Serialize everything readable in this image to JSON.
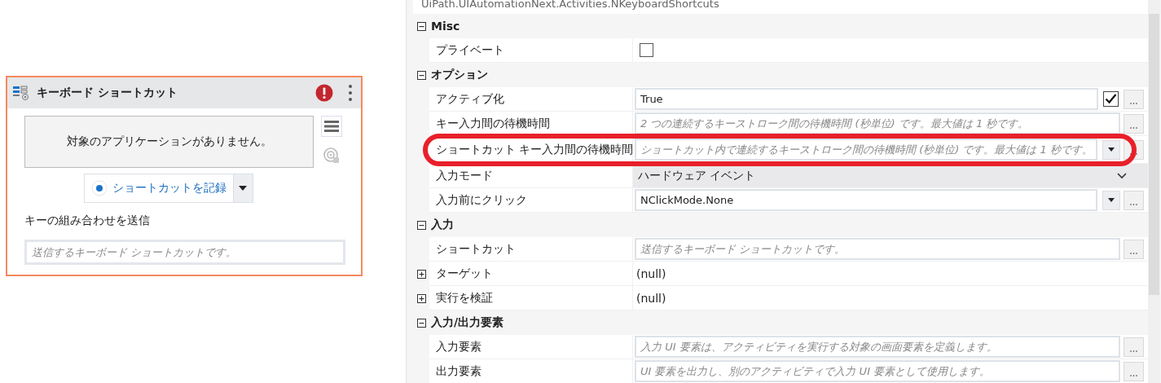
{
  "activity": {
    "title": "キーボード ショートカット",
    "error": true,
    "target_message": "対象のアプリケーションがありません。",
    "record_button": "ショートカットを記録",
    "section_label": "キーの組み合わせを送信",
    "shortcut_field": {
      "placeholder": "送信するキーボード ショートカットです。"
    }
  },
  "properties": {
    "type_name": "UiPath.UIAutomationNext.Activities.NKeyboardShortcuts",
    "rows": [
      {
        "kind": "category",
        "label": "Misc",
        "expanded": true
      },
      {
        "kind": "property",
        "label": "プライベート",
        "editor": {
          "kind": "checkbox",
          "checked": false
        },
        "dots": false,
        "highlighted": false
      },
      {
        "kind": "category",
        "label": "オプション",
        "expanded": true
      },
      {
        "kind": "property",
        "label": "アクティブ化",
        "editor": {
          "kind": "text",
          "value": "True"
        },
        "extra": {
          "kind": "checkbox",
          "checked": true
        },
        "dots": true,
        "highlighted": false
      },
      {
        "kind": "property",
        "label": "キー入力間の待機時間",
        "editor": {
          "kind": "text",
          "placeholder": "2 つの連続するキーストローク間の待機時間 (秒単位) です。最大値は 1 秒です。"
        },
        "dots": true,
        "highlighted": false
      },
      {
        "kind": "property",
        "label": "ショートカット キー入力間の待機時間",
        "editor": {
          "kind": "text",
          "placeholder": "ショートカット内で連続するキーストローク間の待機時間 (秒単位) です。最大値は 1 秒です。"
        },
        "extra": {
          "kind": "dropdown"
        },
        "dots": true,
        "highlighted": true
      },
      {
        "kind": "property",
        "label": "入力モード",
        "editor": {
          "kind": "combo",
          "value": "ハードウェア イベント"
        },
        "dots": false,
        "highlighted": false
      },
      {
        "kind": "property",
        "label": "入力前にクリック",
        "editor": {
          "kind": "text",
          "value": "NClickMode.None"
        },
        "extra": {
          "kind": "dropdown"
        },
        "dots": true,
        "highlighted": false
      },
      {
        "kind": "category",
        "label": "入力",
        "expanded": true
      },
      {
        "kind": "property",
        "label": "ショートカット",
        "editor": {
          "kind": "text",
          "placeholder": "送信するキーボード ショートカットです。"
        },
        "dots": true,
        "highlighted": false
      },
      {
        "kind": "object",
        "label": "ターゲット",
        "value": "(null)",
        "expanded": false
      },
      {
        "kind": "object",
        "label": "実行を検証",
        "value": "(null)",
        "expanded": false
      },
      {
        "kind": "category",
        "label": "入力/出力要素",
        "expanded": true
      },
      {
        "kind": "property",
        "label": "入力要素",
        "editor": {
          "kind": "text",
          "placeholder": "入力 UI 要素は、アクティビティを実行する対象の画面要素を定義します。"
        },
        "dots": true,
        "highlighted": false
      },
      {
        "kind": "property",
        "label": "出力要素",
        "editor": {
          "kind": "text",
          "placeholder": "UI 要素を出力し、別のアクティビティで入力 UI 要素として使用します。"
        },
        "dots": true,
        "highlighted": false
      }
    ]
  }
}
